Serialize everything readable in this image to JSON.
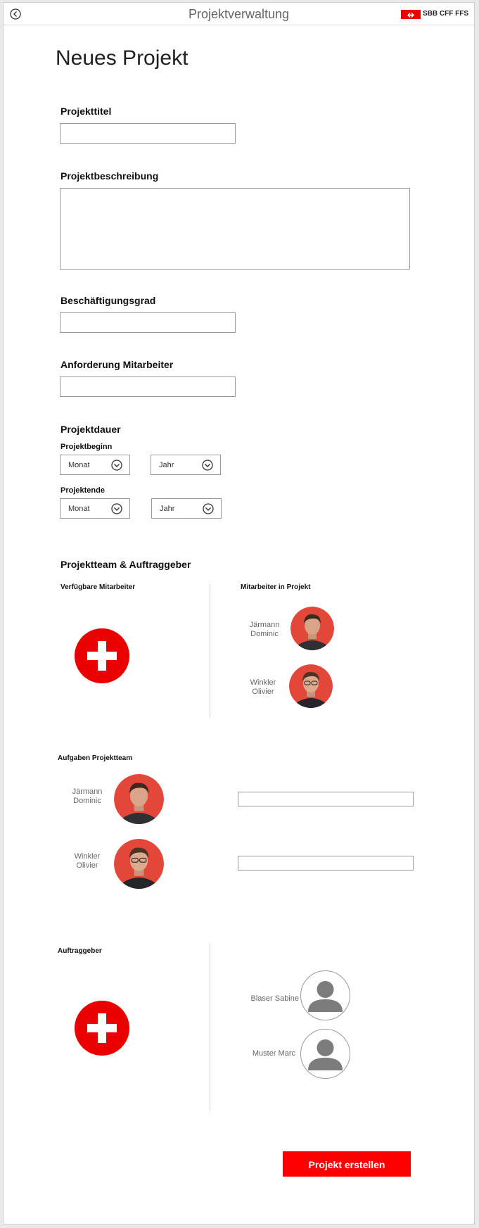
{
  "header": {
    "title": "Projektverwaltung",
    "logo_text": "SBB CFF FFS",
    "brand_color": "#eb0000"
  },
  "page": {
    "title": "Neues Projekt"
  },
  "form": {
    "title_label": "Projekttitel",
    "title_value": "",
    "description_label": "Projektbeschreibung",
    "description_value": "",
    "workload_label": "Beschäftigungsgrad",
    "workload_value": "",
    "requirements_label": "Anforderung Mitarbeiter",
    "requirements_value": "",
    "duration_label": "Projektdauer",
    "start_label": "Projektbeginn",
    "start_month": "Monat",
    "start_year": "Jahr",
    "end_label": "Projektende",
    "end_month": "Monat",
    "end_year": "Jahr"
  },
  "team": {
    "section_label": "Projektteam & Auftraggeber",
    "available_label": "Verfügbare Mitarbeiter",
    "in_project_label": "Mitarbeiter in Projekt",
    "members": [
      {
        "last": "Järmann",
        "first": "Dominic"
      },
      {
        "last": "Winkler",
        "first": "Olivier"
      }
    ]
  },
  "tasks": {
    "section_label": "Aufgaben Projektteam",
    "rows": [
      {
        "last": "Järmann",
        "first": "Dominic",
        "task_value": ""
      },
      {
        "last": "Winkler",
        "first": "Olivier",
        "task_value": ""
      }
    ]
  },
  "clients": {
    "section_label": "Auftraggeber",
    "people": [
      {
        "name": "Blaser Sabine"
      },
      {
        "name": "Muster Marc"
      }
    ]
  },
  "actions": {
    "submit_label": "Projekt erstellen"
  },
  "icons": {
    "back": "back-arrow-circle-icon",
    "dropdown": "chevron-down-circle-icon",
    "add": "swiss-cross-plus-icon",
    "person": "person-silhouette-icon"
  }
}
